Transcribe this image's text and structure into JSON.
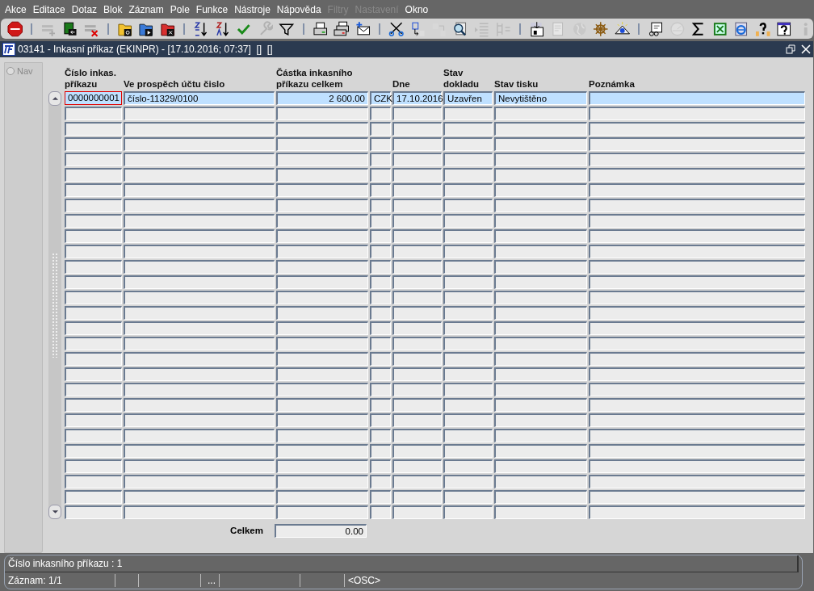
{
  "menu": [
    {
      "label": "Akce",
      "disabled": false
    },
    {
      "label": "Editace",
      "disabled": false
    },
    {
      "label": "Dotaz",
      "disabled": false
    },
    {
      "label": "Blok",
      "disabled": false
    },
    {
      "label": "Záznam",
      "disabled": false
    },
    {
      "label": "Pole",
      "disabled": false
    },
    {
      "label": "Funkce",
      "disabled": false
    },
    {
      "label": "Nástroje",
      "disabled": false
    },
    {
      "label": "Nápověda",
      "disabled": false
    },
    {
      "label": "Filtry",
      "disabled": true
    },
    {
      "label": "Nastavení",
      "disabled": true
    },
    {
      "label": "Okno",
      "disabled": false
    }
  ],
  "toolbar": [
    [
      {
        "disabled": false
      }
    ],
    [
      {
        "disabled": true
      },
      {
        "disabled": false
      },
      {
        "disabled": false
      }
    ],
    [
      {
        "disabled": false
      },
      {
        "disabled": false
      },
      {
        "disabled": false
      }
    ],
    [
      {
        "disabled": false
      },
      {
        "disabled": false
      },
      {
        "disabled": false
      },
      {
        "disabled": true
      },
      {
        "disabled": false
      }
    ],
    [
      {
        "disabled": false
      },
      {
        "disabled": false
      },
      {
        "disabled": false
      }
    ],
    [
      {
        "disabled": false
      },
      {
        "disabled": false
      },
      {
        "disabled": true
      },
      {
        "disabled": false
      },
      {
        "disabled": true
      },
      {
        "disabled": true
      }
    ],
    [
      {
        "disabled": false
      },
      {
        "disabled": true
      },
      {
        "disabled": true
      },
      {
        "disabled": false
      },
      {
        "disabled": false
      }
    ],
    [
      {
        "disabled": false
      },
      {
        "disabled": true
      },
      {
        "disabled": false
      },
      {
        "disabled": false
      },
      {
        "disabled": false
      },
      {
        "disabled": false
      },
      {
        "disabled": false
      },
      {
        "disabled": true
      }
    ]
  ],
  "window": {
    "title": "03141 - Inkasní příkaz (EKINPR) - [17.10.2016; 07:37]  []  []"
  },
  "nav": {
    "label": "Nav",
    "selected": false
  },
  "table": {
    "columns": [
      "Číslo inkas.\npříkazu",
      "Ve prospěch účtu čislo",
      "Částka inkasního\npříkazu celkem",
      null,
      "Dne",
      "Stav\ndokladu",
      "Stav tisku",
      "Poznámka"
    ],
    "rows": [
      {
        "selected": true,
        "cells": [
          "0000000001",
          "číslo-11329/0100",
          "2 600.00",
          "CZK",
          "17.10.2016",
          "Uzavřen",
          "Nevytištěno",
          ""
        ]
      }
    ]
  },
  "total": {
    "label": "Celkem",
    "value": "0.00"
  },
  "status_bar": {
    "message": "Číslo inkasního příkazu : 1",
    "segments": [
      "Záznam: 1/1",
      "...",
      "<OSC>"
    ]
  }
}
